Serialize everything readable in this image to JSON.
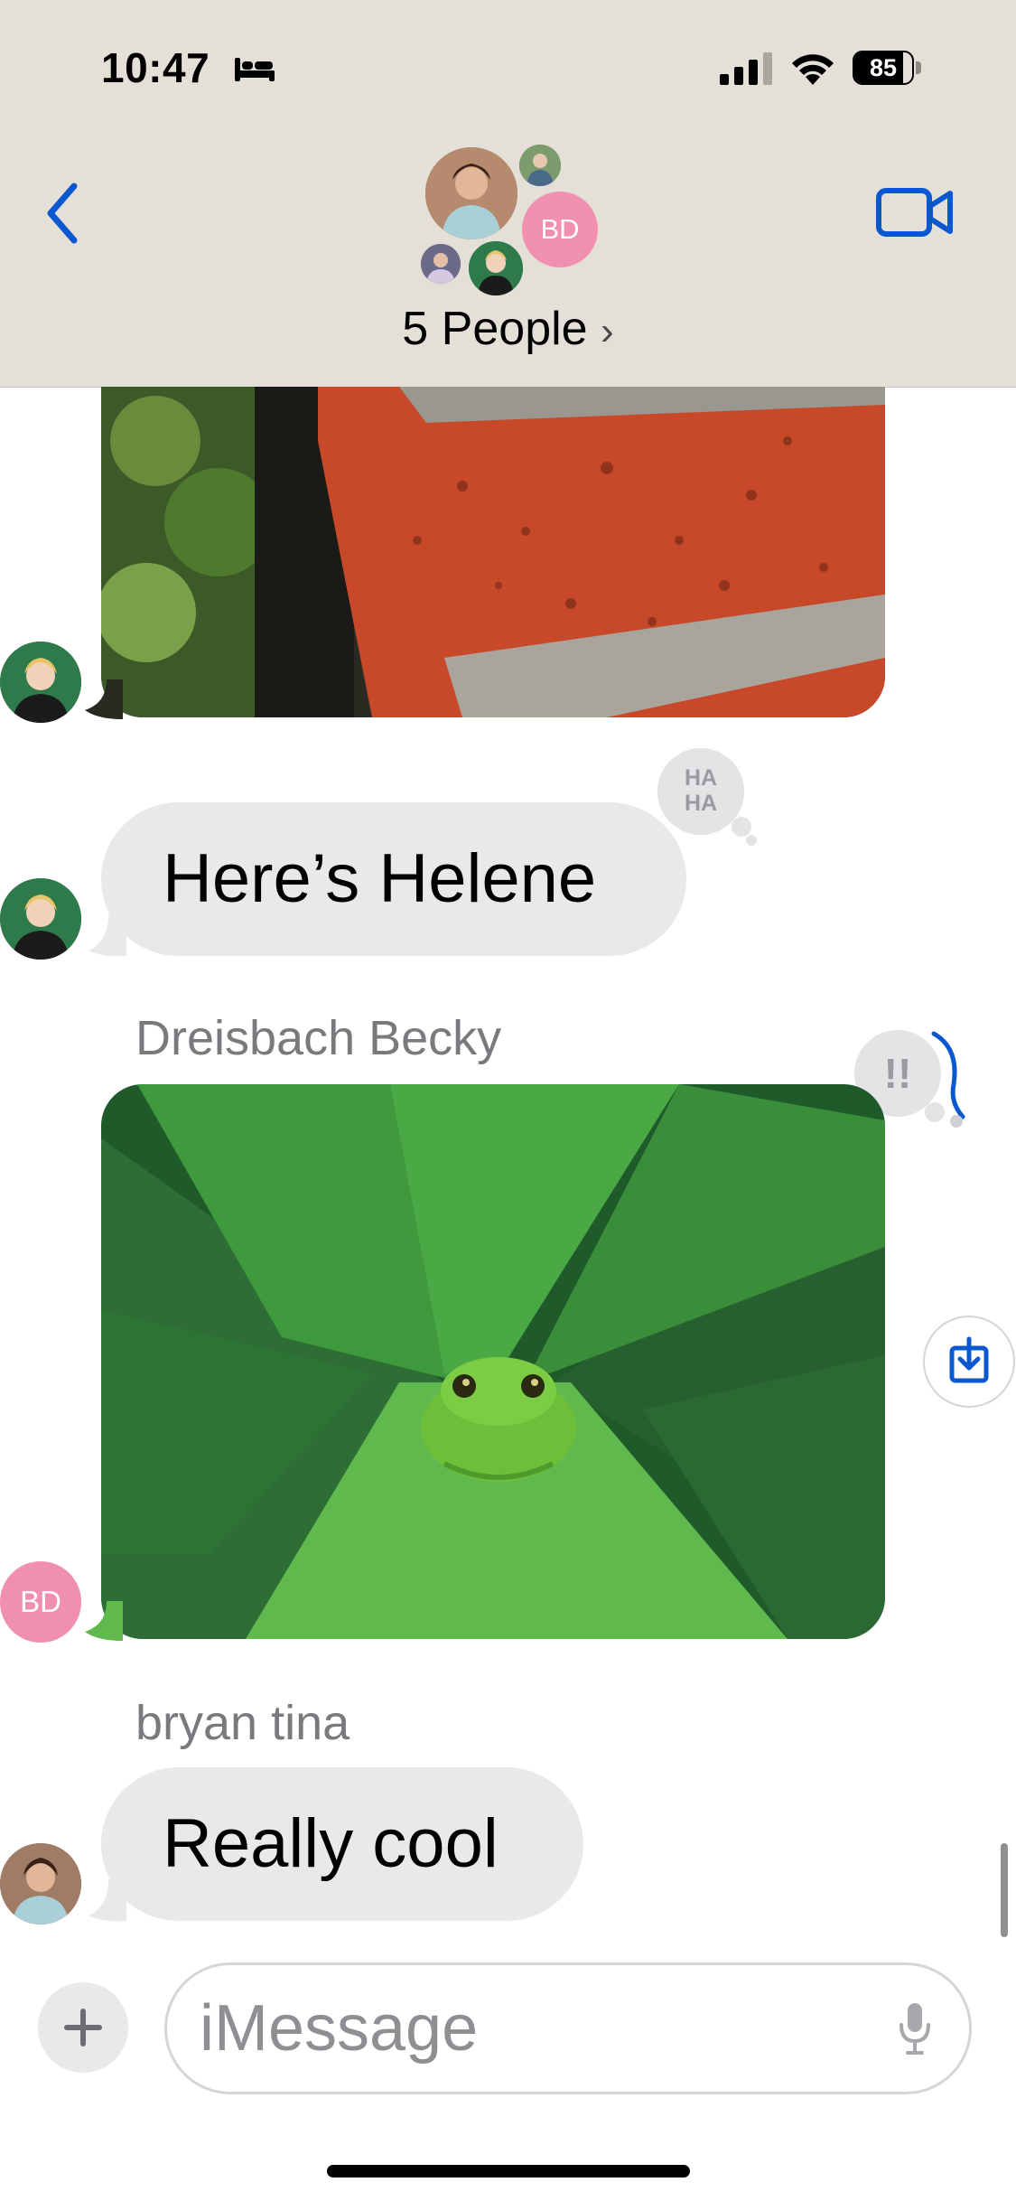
{
  "status_bar": {
    "time": "10:47",
    "battery": "85",
    "battery_level": 0.85
  },
  "header": {
    "back_icon": "chevron-left-icon",
    "video_icon": "video-camera-icon",
    "group_title": "5 People",
    "title_chevron": "›",
    "avatar_initials": "BD",
    "accent_color": "#0a58d0",
    "background_color": "#e4e0d8"
  },
  "messages": {
    "bubble_1_text": "Here’s Helene",
    "tapback_1": {
      "line1": "HA",
      "line2": "HA"
    },
    "sender_1": "Dreisbach Becky",
    "sender_1_initials": "BD",
    "tapback_2": "!!",
    "sender_2": "bryan tina",
    "bubble_2_text": "Really cool",
    "bubble_color": "#e9e9eb"
  },
  "input_bar": {
    "placeholder": "iMessage",
    "plus_label": "+"
  }
}
